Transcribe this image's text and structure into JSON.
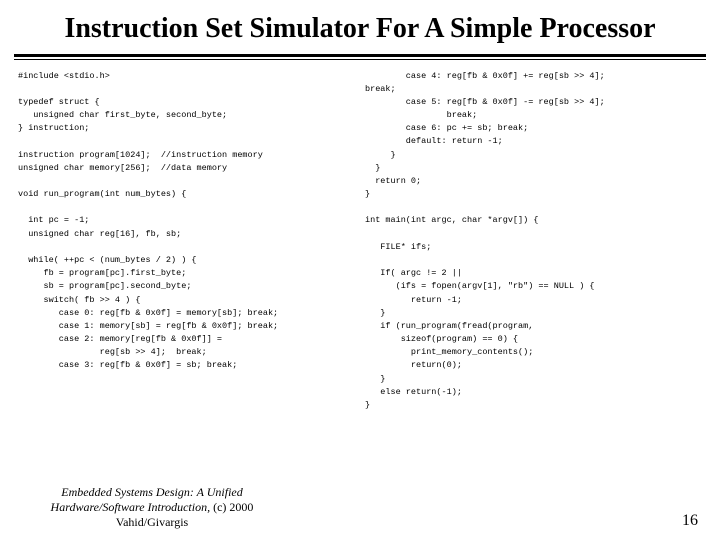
{
  "title": "Instruction Set Simulator For A Simple Processor",
  "code_left": "#include <stdio.h>\n\ntypedef struct {\n   unsigned char first_byte, second_byte;\n} instruction;\n\ninstruction program[1024];  //instruction memory\nunsigned char memory[256];  //data memory\n\nvoid run_program(int num_bytes) {\n\n  int pc = -1;\n  unsigned char reg[16], fb, sb;\n\n  while( ++pc < (num_bytes / 2) ) {\n     fb = program[pc].first_byte;\n     sb = program[pc].second_byte;\n     switch( fb >> 4 ) {\n        case 0: reg[fb & 0x0f] = memory[sb]; break;\n        case 1: memory[sb] = reg[fb & 0x0f]; break;\n        case 2: memory[reg[fb & 0x0f]] =\n                reg[sb >> 4];  break;\n        case 3: reg[fb & 0x0f] = sb; break;",
  "code_right": "        case 4: reg[fb & 0x0f] += reg[sb >> 4];\nbreak;\n        case 5: reg[fb & 0x0f] -= reg[sb >> 4];\n                break;\n        case 6: pc += sb; break;\n        default: return -1;\n     }\n  }\n  return 0;\n}\n\nint main(int argc, char *argv[]) {\n\n   FILE* ifs;\n\n   If( argc != 2 ||\n      (ifs = fopen(argv[1], \"rb\") == NULL ) {\n         return -1;\n   }\n   if (run_program(fread(program,\n       sizeof(program) == 0) {\n         print_memory_contents();\n         return(0);\n   }\n   else return(-1);\n}",
  "footer_book": "Embedded Systems Design: A Unified Hardware/Software Introduction,",
  "footer_copy": " (c) 2000 Vahid/Givargis",
  "page_number": "16"
}
